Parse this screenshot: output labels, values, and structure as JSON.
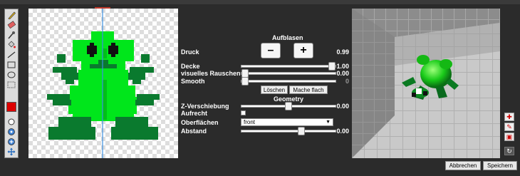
{
  "panel": {
    "header_inflate": "Aufblasen",
    "pressure_label": "Druck",
    "minus_label": "–",
    "plus_label": "+",
    "pressure_value": "0.99",
    "opacity_label": "Decke",
    "opacity_value": "1.00",
    "noise_label": "visuelles Rauschen",
    "noise_value": "0.00",
    "smooth_label": "Smooth",
    "smooth_value": "0",
    "delete_label": "Löschen",
    "make_label": "Mache flach",
    "header_geometry": "Geometry",
    "zshift_label": "Z-Verschiebung",
    "zshift_value": "0.00",
    "upright_label": "Aufrecht",
    "surfaces_label": "Oberflächen",
    "surfaces_selected": "front",
    "distance_label": "Abstand",
    "distance_value": "0.00"
  },
  "levels": {
    "pressure": 0.49,
    "opacity": 1.0,
    "noise": 0.0,
    "smooth": 0.0,
    "zshift": 0.5,
    "distance": 0.65
  },
  "footer": {
    "cancel_label": "Abbrechen",
    "save_label": "Speichern"
  },
  "colors": {
    "accent_red": "#dd0000",
    "frog_light": "#00e61b",
    "frog_dark": "#0a7a2e",
    "guide_line": "#3d8fe0"
  },
  "icons": {
    "left_tools": [
      "pencil-icon",
      "eraser-icon",
      "eyedropper-icon",
      "bucket-fill-icon",
      "line-icon",
      "rectangle-icon",
      "ellipse-icon",
      "select-icon",
      "color-swatch",
      "zoom-out-icon",
      "zoom-icon",
      "zoom-in-icon",
      "move-icon"
    ],
    "right_tools": [
      "add-light-icon",
      "edit-light-icon",
      "remove-light-icon",
      "reset-view-icon"
    ]
  }
}
